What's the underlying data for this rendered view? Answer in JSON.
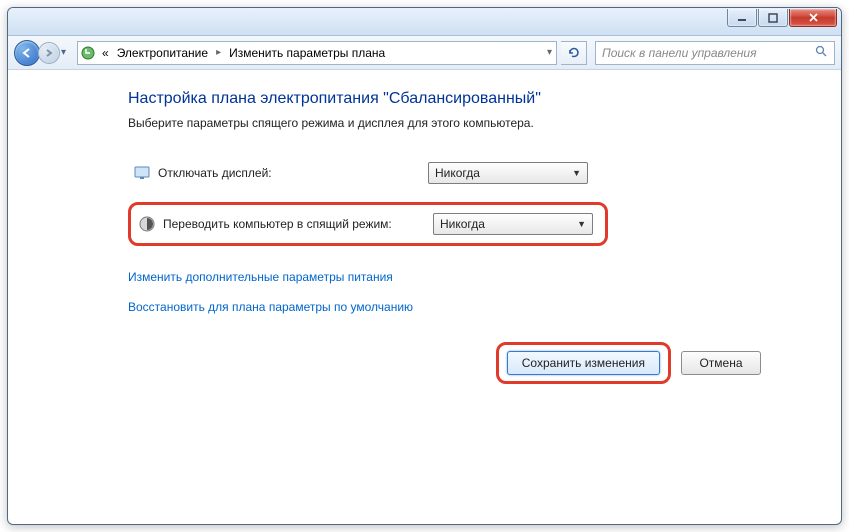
{
  "breadcrumb": {
    "prefix": "«",
    "item1": "Электропитание",
    "item2": "Изменить параметры плана"
  },
  "search": {
    "placeholder": "Поиск в панели управления"
  },
  "heading": "Настройка плана электропитания \"Сбалансированный\"",
  "subtext": "Выберите параметры спящего режима и дисплея для этого компьютера.",
  "rows": {
    "display": {
      "label": "Отключать дисплей:",
      "value": "Никогда"
    },
    "sleep": {
      "label": "Переводить компьютер в спящий режим:",
      "value": "Никогда"
    }
  },
  "links": {
    "advanced": "Изменить дополнительные параметры питания",
    "restore": "Восстановить для плана параметры по умолчанию"
  },
  "buttons": {
    "save": "Сохранить изменения",
    "cancel": "Отмена"
  }
}
